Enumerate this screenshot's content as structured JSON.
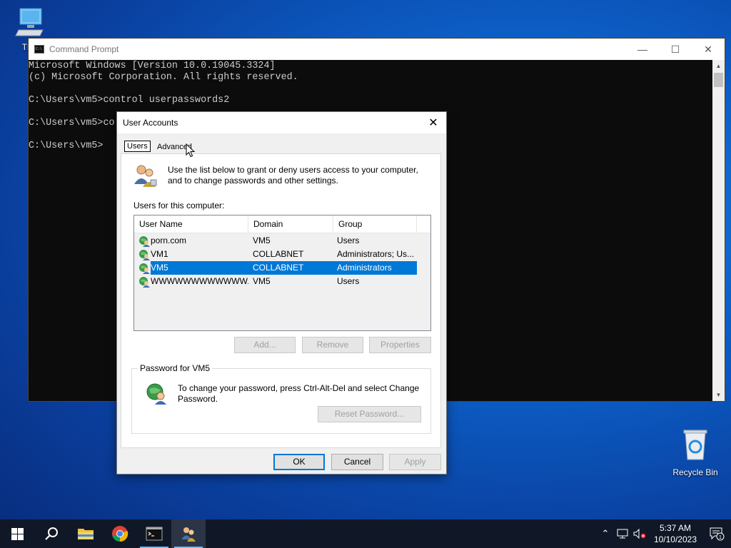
{
  "desktop": {
    "this_pc_label": "This",
    "recycle_bin_label": "Recycle Bin"
  },
  "cmd": {
    "title": "Command Prompt",
    "lines": [
      "Microsoft Windows [Version 10.0.19045.3324]",
      "(c) Microsoft Corporation. All rights reserved.",
      "",
      "C:\\Users\\vm5>control userpasswords2",
      "",
      "C:\\Users\\vm5>co",
      "",
      "C:\\Users\\vm5>"
    ]
  },
  "dialog": {
    "title": "User Accounts",
    "tabs": [
      "Users",
      "Advanced"
    ],
    "intro": "Use the list below to grant or deny users access to your computer, and to change passwords and other settings.",
    "users_label": "Users for this computer:",
    "columns": [
      "User Name",
      "Domain",
      "Group"
    ],
    "rows": [
      {
        "user": "porn.com",
        "domain": "VM5",
        "group": "Users",
        "selected": false
      },
      {
        "user": "VM1",
        "domain": "COLLABNET",
        "group": "Administrators; Us...",
        "selected": false
      },
      {
        "user": "VM5",
        "domain": "COLLABNET",
        "group": "Administrators",
        "selected": true
      },
      {
        "user": "WWWWWWWWWWWW...",
        "domain": "VM5",
        "group": "Users",
        "selected": false
      }
    ],
    "buttons": {
      "add": "Add...",
      "remove": "Remove",
      "properties": "Properties",
      "reset_password": "Reset Password...",
      "ok": "OK",
      "cancel": "Cancel",
      "apply": "Apply"
    },
    "password_group": {
      "legend": "Password for VM5",
      "text": "To change your password, press Ctrl-Alt-Del and select Change Password."
    }
  },
  "taskbar": {
    "clock_time": "5:37 AM",
    "clock_date": "10/10/2023",
    "notification_count": "1"
  },
  "colors": {
    "selection": "#0078d7",
    "taskbar": "#101827"
  }
}
